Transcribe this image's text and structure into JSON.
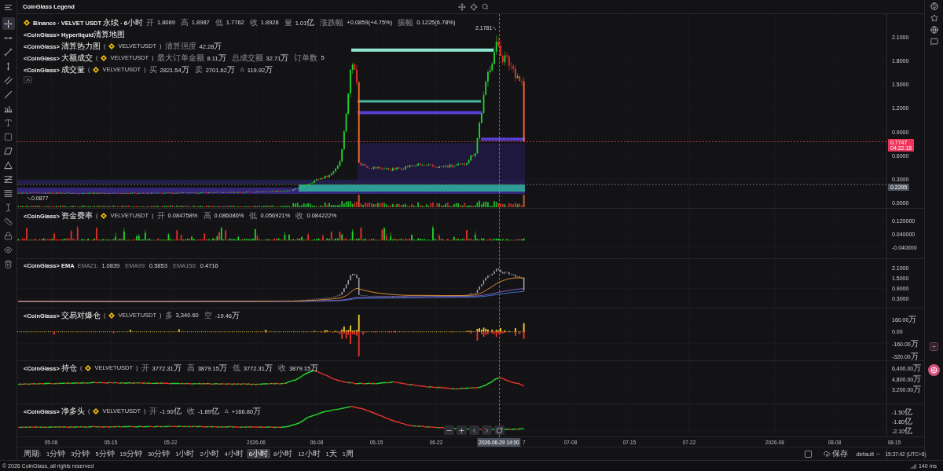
{
  "top_bar": {
    "title": "CoinGlass Legend"
  },
  "drawing_tools": [
    {
      "kind": "crosshair",
      "selected": true
    },
    {
      "kind": "horizontal-line",
      "selected": false
    },
    {
      "kind": "segment",
      "selected": false
    },
    {
      "kind": "vertical-line",
      "selected": false
    },
    {
      "kind": "parallel-lines",
      "selected": false
    },
    {
      "kind": "diagonal-line",
      "selected": false
    },
    {
      "kind": "comb",
      "selected": false
    },
    {
      "kind": "text",
      "selected": false
    },
    {
      "kind": "rectangle",
      "selected": false
    },
    {
      "kind": "parallelogram",
      "selected": false
    },
    {
      "kind": "triangle",
      "selected": false
    },
    {
      "kind": "grid-lines",
      "selected": false
    },
    {
      "kind": "stacked-lines",
      "selected": false
    },
    {
      "kind": "text-cursor",
      "selected": false
    },
    {
      "kind": "ruler",
      "selected": false
    },
    {
      "kind": "lock",
      "selected": false
    },
    {
      "kind": "eye",
      "selected": false
    },
    {
      "kind": "trash",
      "selected": false
    }
  ],
  "main_pane": {
    "legend": {
      "title": "Binance · VELVET USDT 永续 · 6小时",
      "values": [
        {
          "label": "开",
          "value": "1.8069"
        },
        {
          "label": "高",
          "value": "1.8987"
        },
        {
          "label": "低",
          "value": "1.7762"
        },
        {
          "label": "收",
          "value": "1.8928"
        },
        {
          "label": "量",
          "value": "1.01亿"
        },
        {
          "label": "涨跌幅",
          "value": "+0.0859(+4.75%)"
        },
        {
          "label": "振幅",
          "value": "0.1225(6.78%)"
        }
      ]
    },
    "indicators": [
      {
        "title": "<CoinGlass> Hyperliquid清算地图"
      },
      {
        "title": "<CoinGlass> 清算热力图",
        "symbol": {
          "open": "(",
          "ticker": "VELVETUSDT",
          "close": ")"
        },
        "values": [
          {
            "label": "清算强度",
            "value": "42.28万"
          }
        ]
      },
      {
        "title": "<CoinGlass> 大额成交",
        "symbol": {
          "open": "(",
          "ticker": "VELVETUSDT",
          "close": ")"
        },
        "values": [
          {
            "label": "最大订单金额",
            "value": "8.11万"
          },
          {
            "label": "总成交额",
            "value": "32.71万"
          },
          {
            "label": "订单数",
            "value": "5"
          }
        ]
      },
      {
        "title": "<CoinGlass> 成交量",
        "symbol": {
          "open": "(",
          "ticker": "VELVETUSDT",
          "close": ")"
        },
        "values": [
          {
            "label": "买",
            "value": "2821.54万"
          },
          {
            "label": "卖",
            "value": "2701.62万"
          },
          {
            "label": "Δ",
            "value": "119.92万"
          }
        ]
      }
    ],
    "axis_ticks": [
      "2.1000",
      "1.8000",
      "1.5000",
      "1.2000",
      "0.9000",
      "0.6000",
      "0.3000",
      "0.0000"
    ],
    "high_marker": "2.1781",
    "low_marker": "0.0877",
    "last_price": {
      "price": "0.7747",
      "countdown": "04:22:18"
    },
    "price_line_label": "0.2295"
  },
  "sub_panes": [
    {
      "kind": "funding_rate",
      "title": "<CoinGlass> 资金费率",
      "symbol": {
        "open": "(",
        "ticker": "VELVETUSDT",
        "close": ")"
      },
      "values": [
        {
          "label": "开",
          "value": "0.084758%"
        },
        {
          "label": "高",
          "value": "0.086086%"
        },
        {
          "label": "低",
          "value": "0.056921%"
        },
        {
          "label": "收",
          "value": "0.084222%"
        }
      ],
      "axis_ticks": [
        "0.120000",
        "0.040000",
        "-0.040000"
      ]
    },
    {
      "kind": "ema",
      "title": "<CoinGlass> EMA",
      "values": [
        {
          "label": "EMA21:",
          "value": "1.0839"
        },
        {
          "label": "EMA99:",
          "value": "0.5853"
        },
        {
          "label": "EMA150:",
          "value": "0.4716"
        }
      ],
      "axis_ticks": [
        "2.1000",
        "1.5000",
        "0.9000",
        "0.3000"
      ]
    },
    {
      "kind": "liquidation",
      "title": "<CoinGlass> 交易对爆仓",
      "symbol": {
        "open": "(",
        "ticker": "VELVETUSDT",
        "close": ")"
      },
      "values": [
        {
          "label": "多",
          "value": "3,340.60"
        },
        {
          "label": "空",
          "value": "-19.46万"
        }
      ],
      "axis_ticks": [
        "160.00万",
        "0.00",
        "-160.00万",
        "-320.00万"
      ]
    },
    {
      "kind": "open_interest",
      "title": "<CoinGlass> 持仓",
      "symbol": {
        "open": "(",
        "ticker": "VELVETUSDT",
        "close": ")"
      },
      "values": [
        {
          "label": "开",
          "value": "3772.31万"
        },
        {
          "label": "高",
          "value": "3879.15万"
        },
        {
          "label": "低",
          "value": "3772.31万"
        },
        {
          "label": "收",
          "value": "3879.15万"
        }
      ],
      "axis_ticks": [
        "6,400.00万",
        "4,800.00万",
        "3,200.00万"
      ]
    },
    {
      "kind": "net_long",
      "title": "<CoinGlass> 净多头",
      "symbol": {
        "open": "(",
        "ticker": "VELVETUSDT",
        "close": ")"
      },
      "values": [
        {
          "label": "开",
          "value": "-1.90亿"
        },
        {
          "label": "收",
          "value": "-1.89亿"
        },
        {
          "label": "Δ",
          "value": "+166.80万"
        }
      ],
      "axis_ticks": [
        "-1.50亿",
        "-1.80亿",
        "-2.10亿"
      ]
    }
  ],
  "time_axis": {
    "ticks": [
      "05-08",
      "05-15",
      "05-22",
      "2026-06",
      "06-08",
      "06-15",
      "06-22",
      "7",
      "07-08",
      "07-15",
      "07-22",
      "2026-08",
      "08-08",
      "08-15"
    ],
    "crosshair_label": "2026-06-29 14:00"
  },
  "interval_bar": {
    "label": "周期:",
    "intervals": [
      {
        "label": "1分钟",
        "selected": false
      },
      {
        "label": "3分钟",
        "selected": false
      },
      {
        "label": "5分钟",
        "selected": false
      },
      {
        "label": "15分钟",
        "selected": false
      },
      {
        "label": "30分钟",
        "selected": false
      },
      {
        "label": "1小时",
        "selected": false
      },
      {
        "label": "2小时",
        "selected": false
      },
      {
        "label": "4小时",
        "selected": false
      },
      {
        "label": "6小时",
        "selected": true
      },
      {
        "label": "8小时",
        "selected": false
      },
      {
        "label": "12小时",
        "selected": false
      },
      {
        "label": "1天",
        "selected": false
      },
      {
        "label": "1周",
        "selected": false
      }
    ],
    "checkbox": {
      "checked": false
    },
    "save": "保存",
    "layout": "default",
    "clock": "15:37:42 (UTC+8)"
  },
  "footer": {
    "copyright": "© 2026 CoinGlass, all rights reserved",
    "latency": "140 ms"
  }
}
